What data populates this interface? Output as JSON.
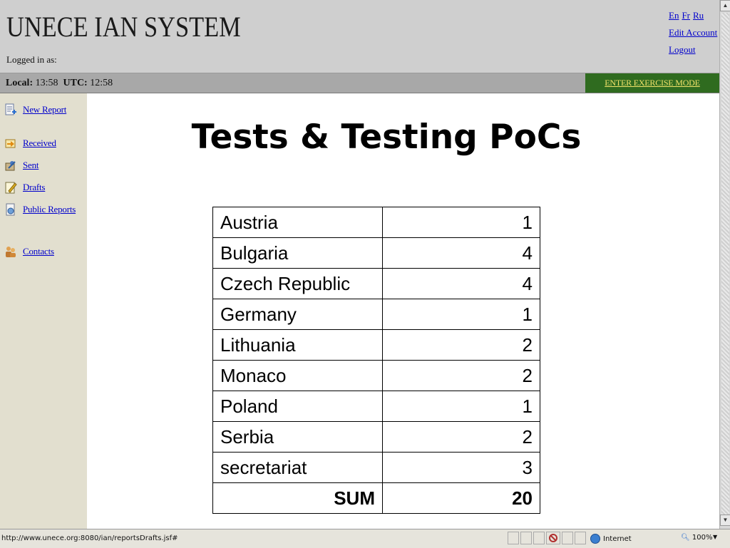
{
  "header": {
    "title": "UNECE IAN SYSTEM",
    "logged_in_label": "Logged in as:",
    "languages": [
      "En",
      "Fr",
      "Ru"
    ],
    "edit_account": "Edit Account",
    "logout": "Logout"
  },
  "timebar": {
    "local_label": "Local:",
    "local_time": "13:58",
    "utc_label": "UTC:",
    "utc_time": "12:58",
    "exercise_mode": "ENTER EXERCISE MODE"
  },
  "sidebar": {
    "items": [
      {
        "label": "New Report",
        "icon": "new-report-icon"
      },
      {
        "label": "Received",
        "icon": "received-icon"
      },
      {
        "label": "Sent",
        "icon": "sent-icon"
      },
      {
        "label": "Drafts",
        "icon": "drafts-icon"
      },
      {
        "label": "Public Reports",
        "icon": "public-reports-icon"
      },
      {
        "label": "Contacts",
        "icon": "contacts-icon"
      }
    ]
  },
  "main": {
    "title": "Tests & Testing PoCs",
    "rows": [
      {
        "country": "Austria",
        "count": "1"
      },
      {
        "country": "Bulgaria",
        "count": "4"
      },
      {
        "country": "Czech Republic",
        "count": "4"
      },
      {
        "country": "Germany",
        "count": "1"
      },
      {
        "country": "Lithuania",
        "count": "2"
      },
      {
        "country": "Monaco",
        "count": "2"
      },
      {
        "country": "Poland",
        "count": "1"
      },
      {
        "country": "Serbia",
        "count": "2"
      },
      {
        "country": "secretariat",
        "count": "3"
      }
    ],
    "sum_label": "SUM",
    "sum_value": "20"
  },
  "statusbar": {
    "url": "http://www.unece.org:8080/ian/reportsDrafts.jsf#",
    "zone": "Internet",
    "zoom": "100%"
  },
  "colors": {
    "header_bg": "#cfcfcf",
    "timebar_bg": "#a8a8a8",
    "exercise_bg": "#2f6b1f",
    "exercise_text": "#f3e36a",
    "sidebar_bg": "#e2dfcf",
    "link": "#0000cc"
  }
}
